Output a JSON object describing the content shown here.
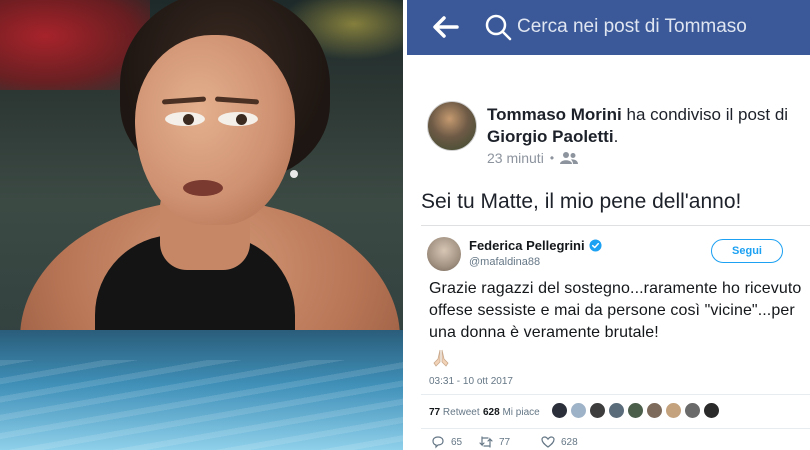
{
  "search": {
    "placeholder": "Cerca nei post di Tommaso"
  },
  "post": {
    "author": "Tommaso Morini",
    "shared_text": "ha condiviso il post di",
    "original_author": "Giorgio Paoletti",
    "time": "23 minuti",
    "audience_icon": "friends-icon",
    "body": "Sei tu Matte, il mio pene dell'anno!"
  },
  "tweet": {
    "name": "Federica Pellegrini",
    "handle": "@mafaldina88",
    "follow_label": "Segui",
    "text": "Grazie ragazzi del sostegno...raramente ho ricevuto offese sessiste e mai da persone così \"vicine\"...per una donna è veramente brutale!",
    "emoji": "🙏🏻",
    "date": "03:31 - 10 ott 2017",
    "retweets": "77",
    "retweets_label": "Retweet",
    "likes": "628",
    "likes_label": "Mi piace",
    "reply_count": "65",
    "retweet_count": "77",
    "like_count": "628",
    "colors": {
      "accent": "#1da1f2",
      "facebook_bar": "#3b5998"
    }
  }
}
